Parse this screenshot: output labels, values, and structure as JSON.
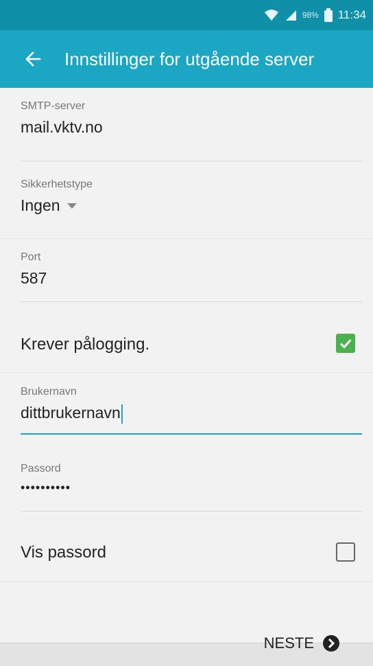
{
  "status_bar": {
    "battery_percent": "98%",
    "time": "11:34",
    "icons": [
      "wifi-icon",
      "signal-icon",
      "battery-icon"
    ]
  },
  "app_bar": {
    "title": "Innstillinger for utgående server",
    "back_icon": "arrow-left-icon"
  },
  "form": {
    "smtp_server": {
      "label": "SMTP-server",
      "value": "mail.vktv.no"
    },
    "security_type": {
      "label": "Sikkerhetstype",
      "value": "Ingen"
    },
    "port": {
      "label": "Port",
      "value": "587"
    },
    "requires_login": {
      "label": "Krever pålogging.",
      "checked": true
    },
    "username": {
      "label": "Brukernavn",
      "value": "dittbrukernavn"
    },
    "password": {
      "label": "Passord",
      "value": "••••••••••"
    },
    "show_password": {
      "label": "Vis passord",
      "checked": false
    }
  },
  "bottom_bar": {
    "next_label": "NESTE"
  },
  "colors": {
    "status_bar": "#0f8fa8",
    "app_bar": "#1ba6c3",
    "checkbox_checked": "#4caf50",
    "focus_underline": "#1ba6c3"
  }
}
